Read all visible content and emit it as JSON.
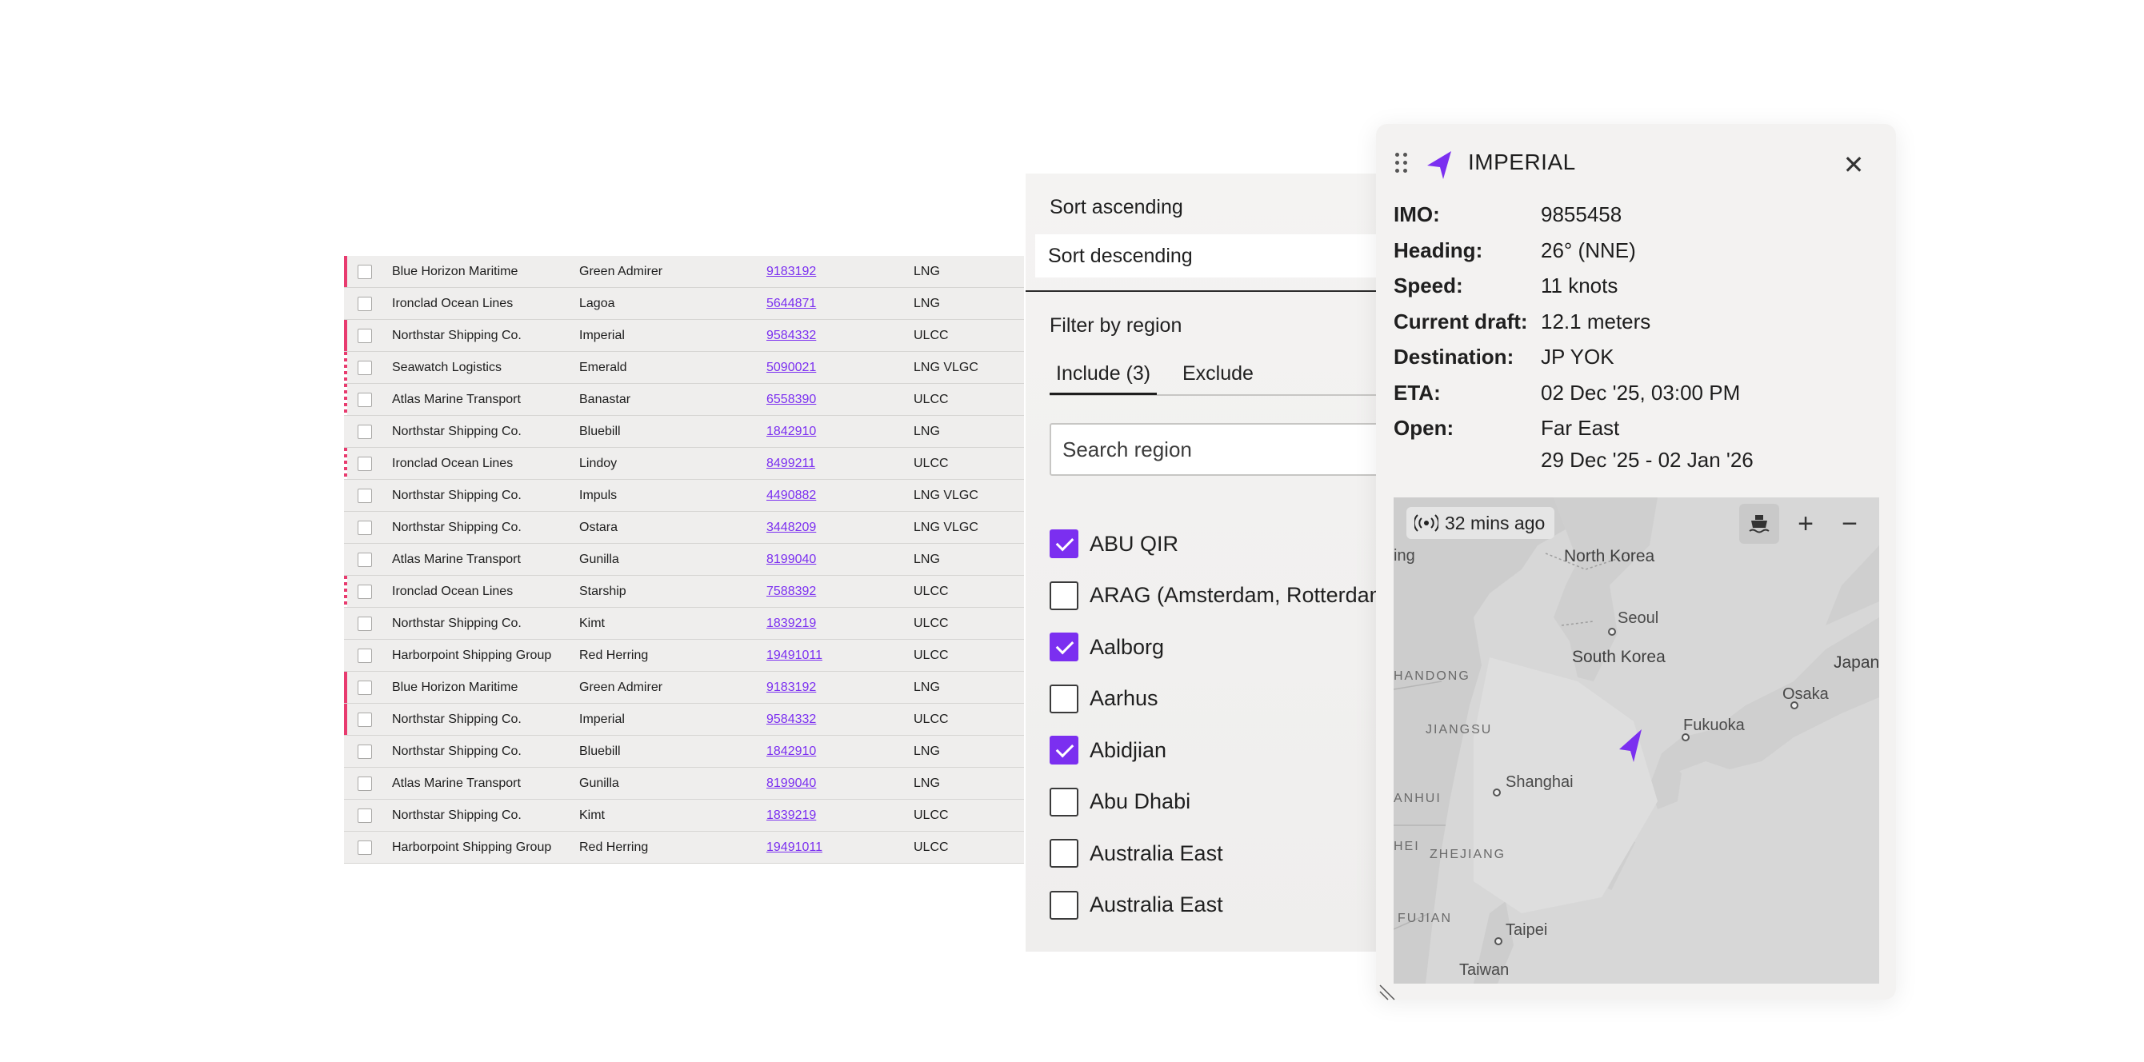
{
  "table": {
    "rows": [
      {
        "owner": "Blue Horizon Maritime",
        "name": "Green Admirer",
        "imo": "9183192",
        "type": "LNG",
        "marker": "solid"
      },
      {
        "owner": "Ironclad Ocean Lines",
        "name": "Lagoa",
        "imo": "5644871",
        "type": "LNG",
        "marker": "none"
      },
      {
        "owner": "Northstar Shipping Co.",
        "name": "Imperial",
        "imo": "9584332",
        "type": "ULCC",
        "marker": "solid"
      },
      {
        "owner": "Seawatch Logistics",
        "name": "Emerald",
        "imo": "5090021",
        "type": "LNG VLGC",
        "marker": "striped"
      },
      {
        "owner": "Atlas Marine Transport",
        "name": "Banastar",
        "imo": "6558390",
        "type": "ULCC",
        "marker": "striped"
      },
      {
        "owner": "Northstar Shipping Co.",
        "name": "Bluebill",
        "imo": "1842910",
        "type": "LNG",
        "marker": "none"
      },
      {
        "owner": "Ironclad Ocean Lines",
        "name": "Lindoy",
        "imo": "8499211",
        "type": "ULCC",
        "marker": "striped"
      },
      {
        "owner": "Northstar Shipping Co.",
        "name": "Impuls",
        "imo": "4490882",
        "type": "LNG VLGC",
        "marker": "none"
      },
      {
        "owner": "Northstar Shipping Co.",
        "name": "Ostara",
        "imo": "3448209",
        "type": "LNG VLGC",
        "marker": "none"
      },
      {
        "owner": "Atlas Marine Transport",
        "name": "Gunilla",
        "imo": "8199040",
        "type": "LNG",
        "marker": "none"
      },
      {
        "owner": "Ironclad Ocean Lines",
        "name": "Starship",
        "imo": "7588392",
        "type": "ULCC",
        "marker": "striped"
      },
      {
        "owner": "Northstar Shipping Co.",
        "name": "Kimt",
        "imo": "1839219",
        "type": "ULCC",
        "marker": "none"
      },
      {
        "owner": "Harborpoint Shipping Group",
        "name": "Red Herring",
        "imo": "19491011",
        "type": "ULCC",
        "marker": "none"
      },
      {
        "owner": "Blue Horizon Maritime",
        "name": "Green Admirer",
        "imo": "9183192",
        "type": "LNG",
        "marker": "solid"
      },
      {
        "owner": "Northstar Shipping Co.",
        "name": "Imperial",
        "imo": "9584332",
        "type": "ULCC",
        "marker": "solid"
      },
      {
        "owner": "Northstar Shipping Co.",
        "name": "Bluebill",
        "imo": "1842910",
        "type": "LNG",
        "marker": "none"
      },
      {
        "owner": "Atlas Marine Transport",
        "name": "Gunilla",
        "imo": "8199040",
        "type": "LNG",
        "marker": "none"
      },
      {
        "owner": "Northstar Shipping Co.",
        "name": "Kimt",
        "imo": "1839219",
        "type": "ULCC",
        "marker": "none"
      },
      {
        "owner": "Harborpoint Shipping Group",
        "name": "Red Herring",
        "imo": "19491011",
        "type": "ULCC",
        "marker": "none"
      }
    ]
  },
  "filter": {
    "sort_ascending": "Sort ascending",
    "sort_descending": "Sort descending",
    "title": "Filter by region",
    "tab_include": "Include (3)",
    "tab_exclude": "Exclude",
    "search_placeholder": "Search region",
    "options": [
      {
        "label": "ABU QIR",
        "checked": true
      },
      {
        "label": "ARAG (Amsterdam, Rotterdam, Antwerp, Ghent)",
        "checked": false
      },
      {
        "label": "Aalborg",
        "checked": true
      },
      {
        "label": "Aarhus",
        "checked": false
      },
      {
        "label": "Abidjian",
        "checked": true
      },
      {
        "label": "Abu Dhabi",
        "checked": false
      },
      {
        "label": "Australia East",
        "checked": false
      },
      {
        "label": "Australia East",
        "checked": false
      }
    ]
  },
  "vessel": {
    "title": "IMPERIAL",
    "accent": "#7b2ff0",
    "fields": [
      {
        "label": "IMO:",
        "value": "9855458"
      },
      {
        "label": "Heading:",
        "value": "26° (NNE)"
      },
      {
        "label": "Speed:",
        "value": "11 knots"
      },
      {
        "label": "Current draft:",
        "value": "12.1 meters"
      },
      {
        "label": "Destination:",
        "value": "JP YOK"
      },
      {
        "label": "ETA:",
        "value": "02 Dec '25, 03:00 PM"
      },
      {
        "label": "Open:",
        "value": "Far East"
      }
    ],
    "open_dates": "29 Dec '25 - 02 Jan '26"
  },
  "map": {
    "last_update": "32 mins ago",
    "zoom_in": "+",
    "zoom_out": "−",
    "labels": {
      "ing": "ing",
      "north_korea": "North Korea",
      "seoul": "Seoul",
      "hangdong": "HANDONG",
      "south_korea": "South Korea",
      "japan": "Japan",
      "osaka": "Osaka",
      "jiangsu": "JIANGSU",
      "fukuoka": "Fukuoka",
      "anhui": "ANHUI",
      "shanghai": "Shanghai",
      "hei": "HEI",
      "zhejiang": "ZHEJIANG",
      "fujian": "FUJIAN",
      "taipei": "Taipei",
      "taiwan": "Taiwan"
    }
  }
}
